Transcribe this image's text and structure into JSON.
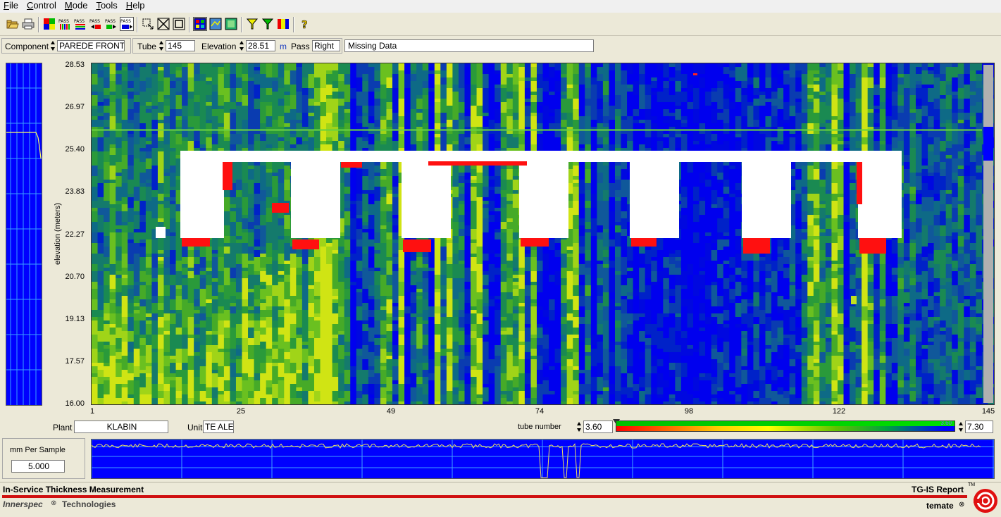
{
  "menu": [
    "File",
    "Control",
    "Mode",
    "Tools",
    "Help"
  ],
  "toolbar": {
    "pass_label": "PASS",
    "help_glyph": "?",
    "icons": [
      "open-folder-icon",
      "print-icon",
      "color-grid-icon",
      "pass-icon",
      "pass-icon",
      "pass-icon",
      "pass-icon",
      "pass-icon",
      "select-arrow-icon",
      "fit-icon",
      "zoom-box-icon",
      "color-map-icon",
      "view-icon",
      "view-icon",
      "filter-icon",
      "filter-icon",
      "palette-icon",
      "help-icon"
    ]
  },
  "fields": {
    "component_label": "Component",
    "component_value": "PAREDE FRONTA",
    "tube_label": "Tube",
    "tube_value": "145",
    "elevation_label": "Elevation",
    "elevation_value": "28.51",
    "elevation_unit": "m",
    "pass_label": "Pass",
    "pass_value": "Right",
    "message": "Missing Data"
  },
  "chart_data": {
    "type": "heatmap",
    "ylabel": "elevation (meters)",
    "xlabel": "tube number",
    "y_ticks": [
      "28.53",
      "26.97",
      "25.40",
      "23.83",
      "22.27",
      "20.70",
      "19.13",
      "17.57",
      "16.00"
    ],
    "x_ticks": [
      "1",
      "25",
      "49",
      "74",
      "98",
      "122",
      "145"
    ],
    "ylim": [
      16.0,
      28.53
    ],
    "xlim": [
      1,
      145
    ],
    "color_min": "3.60",
    "color_max": "7.30",
    "color_mid_label": "3.60",
    "colors": {
      "low": "#ff0000",
      "mid": "#ffff00",
      "high": "#00c000",
      "over": "#0000ff",
      "missing": "#ffffff"
    }
  },
  "info": {
    "plant_label": "Plant",
    "plant_value": "KLABIN",
    "unit_label": "Unit",
    "unit_value": "TE ALE",
    "mm_label": "mm Per Sample",
    "mm_value": "5.000"
  },
  "status": {
    "title": "In-Service Thickness Measurement",
    "report": "TG-IS Report",
    "tm": "TM",
    "brand1": "Innerspec",
    "brand2": "Technologies",
    "brand3": "temate"
  }
}
